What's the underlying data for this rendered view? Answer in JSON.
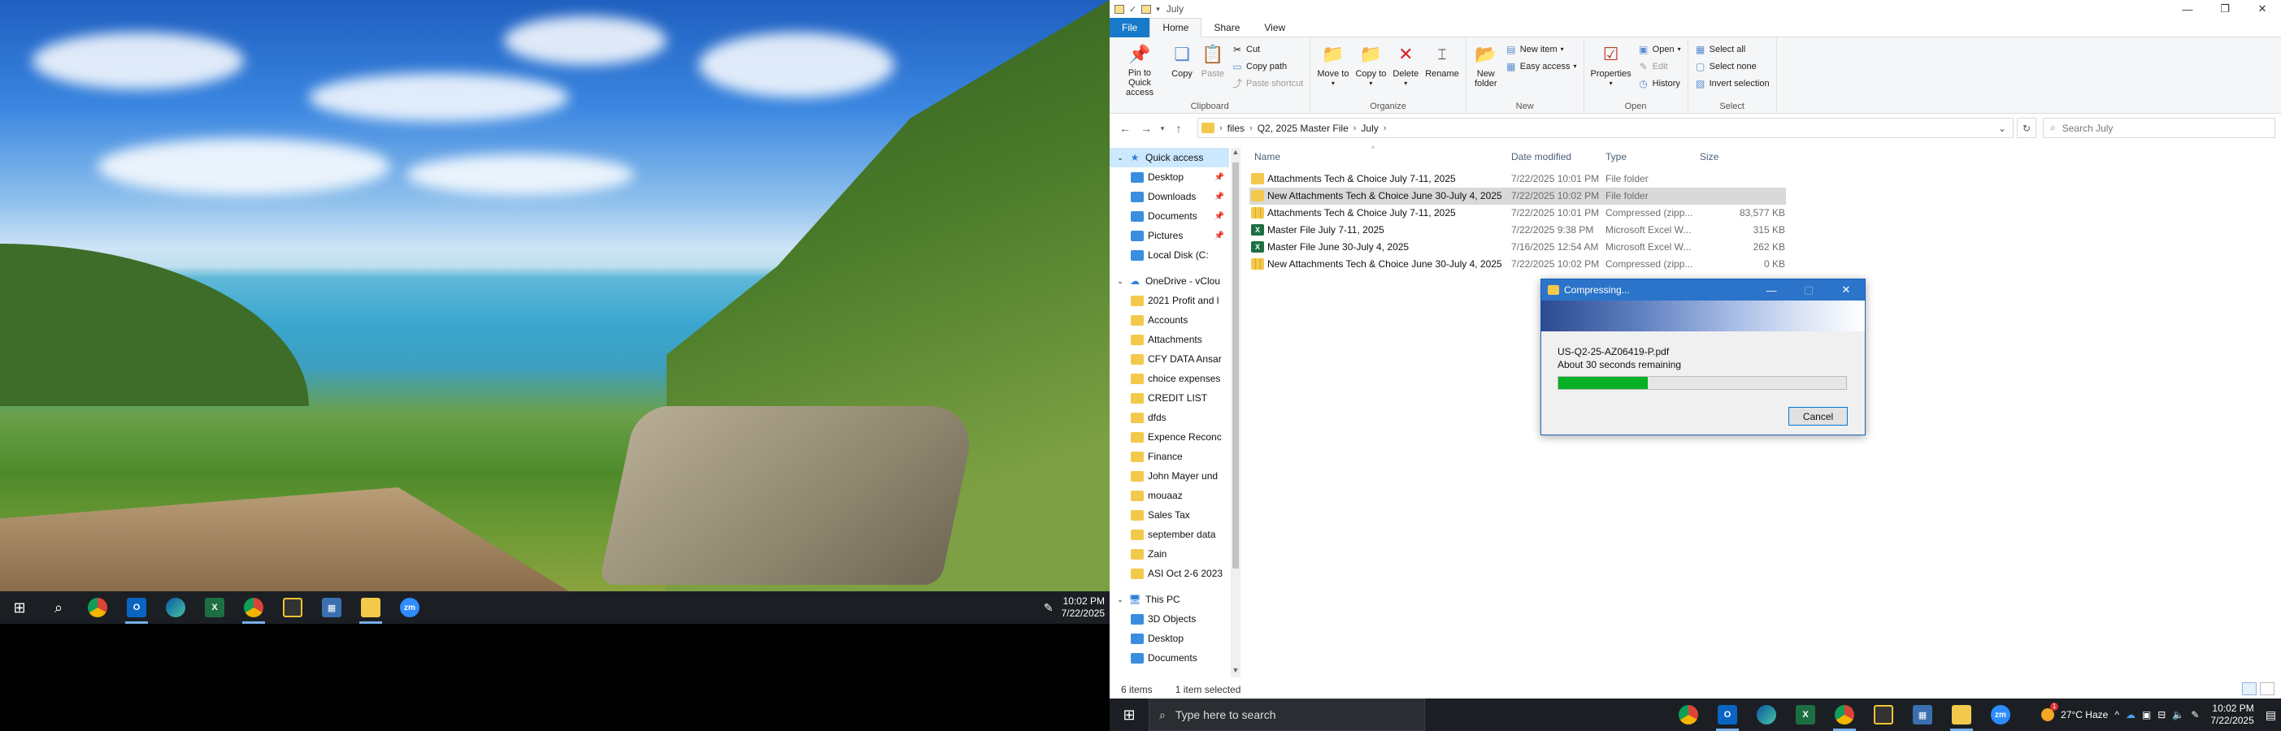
{
  "left_taskbar": {
    "time": "10:02 PM",
    "date": "7/22/2025"
  },
  "window": {
    "title": "July",
    "tabs": [
      "File",
      "Home",
      "Share",
      "View"
    ]
  },
  "ribbon": {
    "clipboard": {
      "label": "Clipboard",
      "pin": "Pin to Quick access",
      "copy": "Copy",
      "paste": "Paste",
      "cut": "Cut",
      "copy_path": "Copy path",
      "paste_shortcut": "Paste shortcut"
    },
    "organize": {
      "label": "Organize",
      "move_to": "Move to",
      "copy_to": "Copy to",
      "delete": "Delete",
      "rename": "Rename"
    },
    "new": {
      "label": "New",
      "new_folder": "New folder",
      "new_item": "New item",
      "easy_access": "Easy access"
    },
    "open": {
      "label": "Open",
      "properties": "Properties",
      "open": "Open",
      "edit": "Edit",
      "history": "History"
    },
    "select": {
      "label": "Select",
      "select_all": "Select all",
      "select_none": "Select none",
      "invert": "Invert selection"
    }
  },
  "address": {
    "path": [
      "files",
      "Q2, 2025 Master File",
      "July"
    ],
    "search_placeholder": "Search July"
  },
  "nav": {
    "quick_access": "Quick access",
    "quick_items": [
      "Desktop",
      "Downloads",
      "Documents",
      "Pictures",
      "Local Disk (C:"
    ],
    "onedrive": "OneDrive - vClou",
    "onedrive_items": [
      "2021 Profit and l",
      "Accounts",
      "Attachments",
      "CFY DATA Ansar",
      "choice expenses",
      "CREDIT LIST",
      "dfds",
      "Expence Reconc",
      "Finance",
      "John Mayer und",
      "mouaaz",
      "Sales Tax",
      "september data",
      "Zain",
      "ASI Oct 2-6 2023"
    ],
    "this_pc": "This PC",
    "pc_items": [
      "3D Objects",
      "Desktop",
      "Documents"
    ]
  },
  "columns": {
    "name": "Name",
    "date": "Date modified",
    "type": "Type",
    "size": "Size"
  },
  "files": [
    {
      "name": "Attachments  Tech & Choice July 7-11, 2025",
      "date": "7/22/2025 10:01 PM",
      "type": "File folder",
      "size": "",
      "icon": "folder"
    },
    {
      "name": "New Attachments Tech & Choice June 30-July 4, 2025",
      "date": "7/22/2025 10:02 PM",
      "type": "File folder",
      "size": "",
      "icon": "folder"
    },
    {
      "name": "Attachments  Tech & Choice July 7-11, 2025",
      "date": "7/22/2025 10:01 PM",
      "type": "Compressed (zipp...",
      "size": "83,577 KB",
      "icon": "zip"
    },
    {
      "name": "Master File July 7-11, 2025",
      "date": "7/22/2025 9:38 PM",
      "type": "Microsoft Excel W...",
      "size": "315 KB",
      "icon": "excel"
    },
    {
      "name": "Master File June 30-July 4, 2025",
      "date": "7/16/2025 12:54 AM",
      "type": "Microsoft Excel W...",
      "size": "262 KB",
      "icon": "excel"
    },
    {
      "name": "New Attachments Tech & Choice June 30-July 4, 2025",
      "date": "7/22/2025 10:02 PM",
      "type": "Compressed (zipp...",
      "size": "0 KB",
      "icon": "zip"
    }
  ],
  "status": {
    "items": "6 items",
    "selected": "1 item selected"
  },
  "dialog": {
    "title": "Compressing...",
    "file": "US-Q2-25-AZ06419-P.pdf",
    "remaining": "About 30 seconds remaining",
    "progress": 0.31,
    "cancel": "Cancel"
  },
  "right_taskbar": {
    "search_placeholder": "Type here to search",
    "weather": "27°C  Haze",
    "time": "10:02 PM",
    "date": "7/22/2025"
  }
}
